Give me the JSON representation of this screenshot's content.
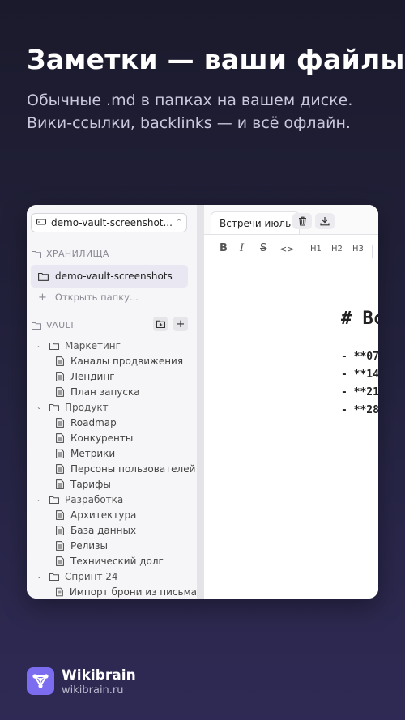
{
  "hero": {
    "title": "Заметки — ваши файлы",
    "subtitle_line1": "Обычные .md в папках на вашем диске.",
    "subtitle_line2": "Вики-ссылки, backlinks — и всё офлайн."
  },
  "sidebar": {
    "vault_select_value": "demo-vault-screenshot...",
    "storage_header": "ХРАНИЛИЩА",
    "storage_item": "demo-vault-screenshots",
    "open_folder": "Открыть папку...",
    "vault_header": "VAULT",
    "tree": [
      {
        "type": "folder",
        "label": "Маркетинг"
      },
      {
        "type": "file",
        "label": "Каналы продвижения"
      },
      {
        "type": "file",
        "label": "Лендинг"
      },
      {
        "type": "file",
        "label": "План запуска"
      },
      {
        "type": "folder",
        "label": "Продукт"
      },
      {
        "type": "file",
        "label": "Roadmap"
      },
      {
        "type": "file",
        "label": "Конкуренты"
      },
      {
        "type": "file",
        "label": "Метрики"
      },
      {
        "type": "file",
        "label": "Персоны пользователей"
      },
      {
        "type": "file",
        "label": "Тарифы"
      },
      {
        "type": "folder",
        "label": "Разработка"
      },
      {
        "type": "file",
        "label": "Архитектура"
      },
      {
        "type": "file",
        "label": "База данных"
      },
      {
        "type": "file",
        "label": "Релизы"
      },
      {
        "type": "file",
        "label": "Технический долг"
      },
      {
        "type": "folder",
        "label": "Спринт 24"
      },
      {
        "type": "file",
        "label": "Импорт брони из письма"
      }
    ]
  },
  "editor": {
    "tab_label": "Встречи июль",
    "toolbar": {
      "bold": "B",
      "italic": "I",
      "strike": "S",
      "code": "<>",
      "h1": "H1",
      "h2": "H2",
      "h3": "H3"
    },
    "heading": "# Вс",
    "lines": [
      "- **07",
      "- **14",
      "- **21",
      "- **28"
    ]
  },
  "brand": {
    "name": "Wikibrain",
    "url": "wikibrain.ru",
    "accent": "#7b6cf0"
  }
}
